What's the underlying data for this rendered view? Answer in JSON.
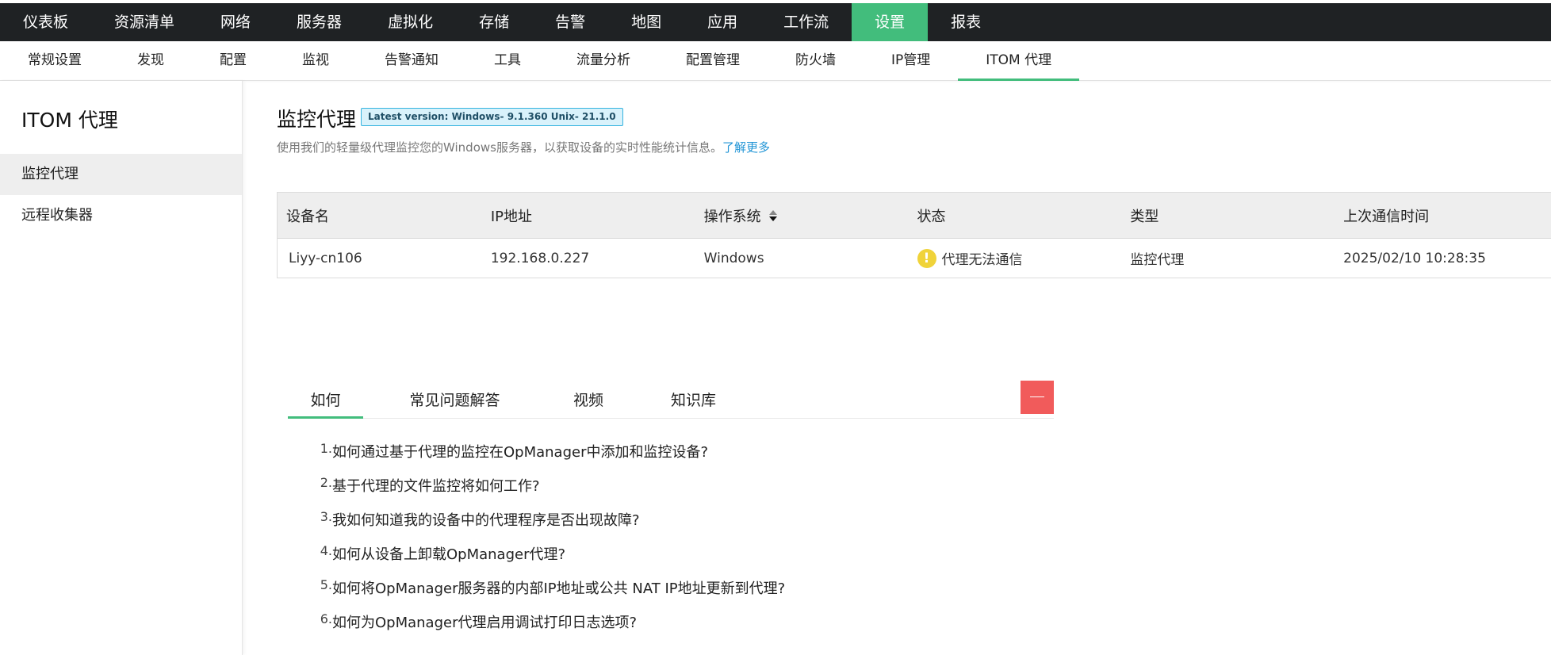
{
  "top_nav": [
    {
      "label": "仪表板"
    },
    {
      "label": "资源清单"
    },
    {
      "label": "网络"
    },
    {
      "label": "服务器"
    },
    {
      "label": "虚拟化"
    },
    {
      "label": "存储"
    },
    {
      "label": "告警"
    },
    {
      "label": "地图"
    },
    {
      "label": "应用"
    },
    {
      "label": "工作流"
    },
    {
      "label": "设置",
      "active": true
    },
    {
      "label": "报表"
    }
  ],
  "sub_nav": [
    {
      "label": "常规设置"
    },
    {
      "label": "发现"
    },
    {
      "label": "配置"
    },
    {
      "label": "监视"
    },
    {
      "label": "告警通知"
    },
    {
      "label": "工具"
    },
    {
      "label": "流量分析"
    },
    {
      "label": "配置管理"
    },
    {
      "label": "防火墙"
    },
    {
      "label": "IP管理"
    },
    {
      "label": "ITOM 代理",
      "active": true
    }
  ],
  "sidebar": {
    "title": "ITOM 代理",
    "items": [
      {
        "label": "监控代理",
        "active": true
      },
      {
        "label": "远程收集器"
      }
    ]
  },
  "main": {
    "title": "监控代理",
    "version_badge": "Latest version: Windows- 9.1.360 Unix- 21.1.0",
    "description": "使用我们的轻量级代理监控您的Windows服务器，以获取设备的实时性能统计信息。",
    "learn_more": "了解更多"
  },
  "table": {
    "columns": [
      "设备名",
      "IP地址",
      "操作系统",
      "状态",
      "类型",
      "上次通信时间"
    ],
    "rows": [
      {
        "device": "Liyy-cn106",
        "ip": "192.168.0.227",
        "os": "Windows",
        "status": "代理无法通信",
        "type": "监控代理",
        "last_comm": "2025/02/10 10:28:35"
      }
    ]
  },
  "tabs": [
    {
      "label": "如何",
      "active": true
    },
    {
      "label": "常见问题解答"
    },
    {
      "label": "视频"
    },
    {
      "label": "知识库"
    }
  ],
  "howto": [
    {
      "num": "1.",
      "text": "如何通过基于代理的监控在OpManager中添加和监控设备?"
    },
    {
      "num": "2.",
      "text": "基于代理的文件监控将如何工作?"
    },
    {
      "num": "3.",
      "text": "我如何知道我的设备中的代理程序是否出现故障?"
    },
    {
      "num": "4.",
      "text": "如何从设备上卸载OpManager代理?"
    },
    {
      "num": "5.",
      "text": "如何将OpManager服务器的内部IP地址或公共 NAT IP地址更新到代理?"
    },
    {
      "num": "6.",
      "text": "如何为OpManager代理启用调试打印日志选项?"
    }
  ],
  "colors": {
    "topbar_bg": "#1f2224",
    "accent_green": "#42bd7c",
    "link_blue": "#2295d6",
    "badge_border": "#35b3df",
    "warning_yellow": "#f0d33a",
    "collapse_red": "#f15b5b"
  }
}
